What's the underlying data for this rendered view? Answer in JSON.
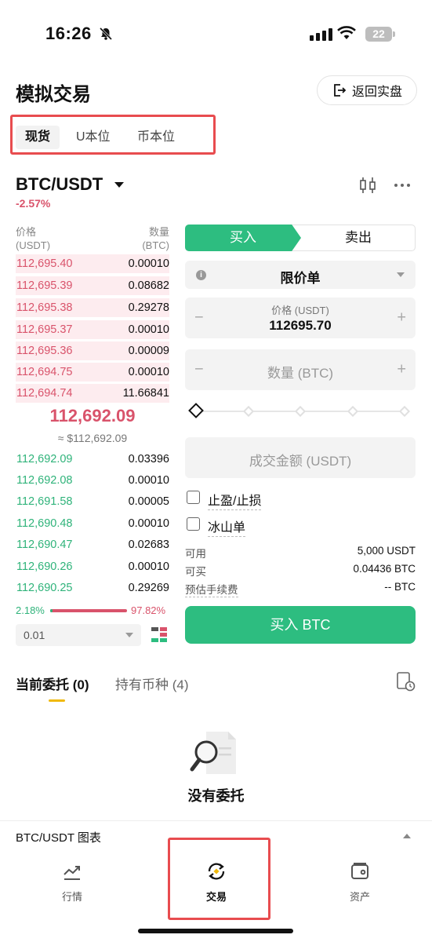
{
  "status_bar": {
    "time": "16:26",
    "battery": "22"
  },
  "header": {
    "title": "模拟交易",
    "back_button": "返回实盘"
  },
  "market_tabs": [
    {
      "label": "现货"
    },
    {
      "label": "U本位"
    },
    {
      "label": "币本位"
    }
  ],
  "pair": {
    "name": "BTC/USDT",
    "change": "-2.57%"
  },
  "order_book": {
    "price_header": "价格",
    "price_unit": "(USDT)",
    "qty_header": "数量",
    "qty_unit": "(BTC)",
    "asks": [
      {
        "price": "112,695.40",
        "qty": "0.00010"
      },
      {
        "price": "112,695.39",
        "qty": "0.08682"
      },
      {
        "price": "112,695.38",
        "qty": "0.29278"
      },
      {
        "price": "112,695.37",
        "qty": "0.00010"
      },
      {
        "price": "112,695.36",
        "qty": "0.00009"
      },
      {
        "price": "112,694.75",
        "qty": "0.00010"
      },
      {
        "price": "112,694.74",
        "qty": "11.66841"
      }
    ],
    "last_price": "112,692.09",
    "last_price_fiat": "≈ $112,692.09",
    "bids": [
      {
        "price": "112,692.09",
        "qty": "0.03396"
      },
      {
        "price": "112,692.08",
        "qty": "0.00010"
      },
      {
        "price": "112,691.58",
        "qty": "0.00005"
      },
      {
        "price": "112,690.48",
        "qty": "0.00010"
      },
      {
        "price": "112,690.47",
        "qty": "0.02683"
      },
      {
        "price": "112,690.26",
        "qty": "0.00010"
      },
      {
        "price": "112,690.25",
        "qty": "0.29269"
      }
    ],
    "buy_ratio": "2.18%",
    "sell_ratio": "97.82%",
    "depth": "0.01"
  },
  "order_form": {
    "buy_tab": "买入",
    "sell_tab": "卖出",
    "order_type": "限价单",
    "price_label": "价格 (USDT)",
    "price_value": "112695.70",
    "qty_placeholder": "数量 (BTC)",
    "amount_placeholder": "成交金额 (USDT)",
    "tp_sl": "止盈/止损",
    "iceberg": "冰山单",
    "available_label": "可用",
    "available_value": "5,000 USDT",
    "can_buy_label": "可买",
    "can_buy_value": "0.04436 BTC",
    "fee_label": "预估手续费",
    "fee_value": "-- BTC",
    "submit": "买入 BTC"
  },
  "orders": {
    "tab_open": "当前委托 (0)",
    "tab_holdings": "持有币种 (4)",
    "empty": "没有委托"
  },
  "chart_bar": {
    "label": "BTC/USDT 图表"
  },
  "bottom_nav": [
    {
      "label": "行情"
    },
    {
      "label": "交易"
    },
    {
      "label": "资产"
    }
  ],
  "colors": {
    "buy": "#2dbd80",
    "sell": "#d9536b",
    "highlight_box": "#e84c4f",
    "accent": "#f0b90b"
  }
}
